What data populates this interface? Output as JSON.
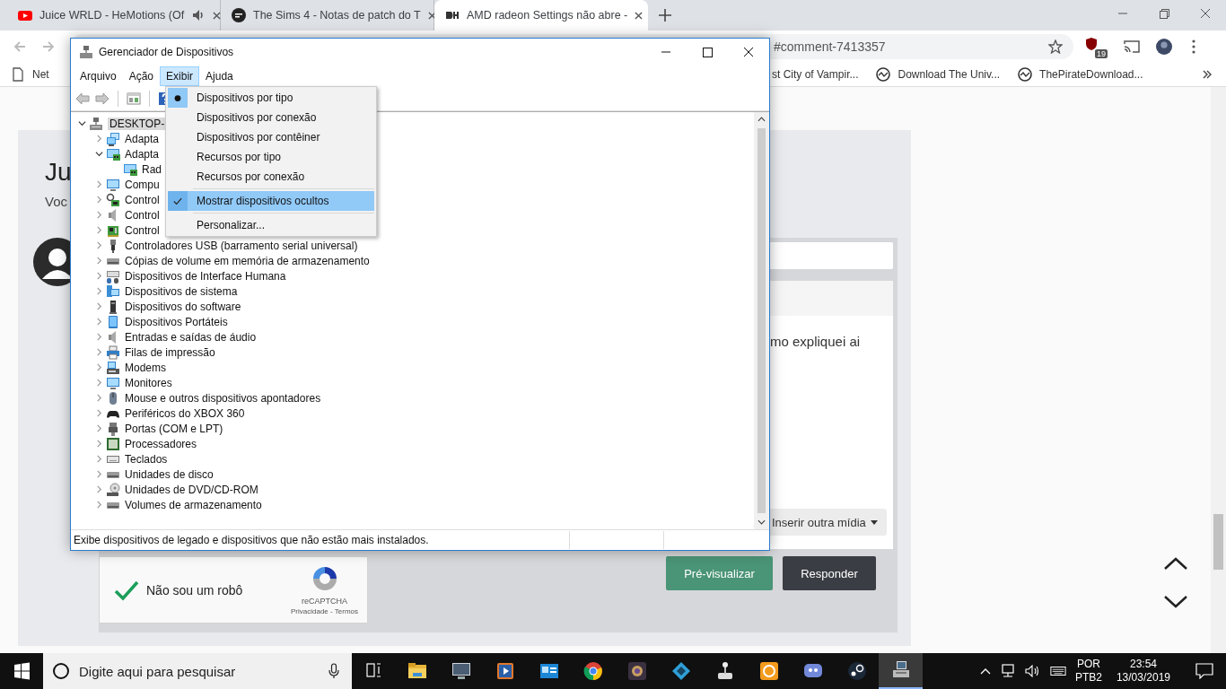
{
  "browser": {
    "tabs": [
      {
        "title": "Juice WRLD - HeMotions (Of",
        "kind": "youtube",
        "audio": true,
        "selected": false
      },
      {
        "title": "The Sims 4 - Notas de patch do T",
        "kind": "ea",
        "audio": false,
        "selected": false
      },
      {
        "title": "AMD radeon Settings não abre -",
        "kind": "logo",
        "audio": false,
        "selected": true
      }
    ],
    "address": "#comment-7413357",
    "extension_badge": "19",
    "bookmarks": [
      {
        "label": "Net",
        "kind": "page"
      },
      {
        "label": "st City of Vampir...",
        "kind": "none"
      },
      {
        "label": "Download The Univ...",
        "kind": "circle"
      },
      {
        "label": "ThePirateDownload...",
        "kind": "circle"
      }
    ]
  },
  "page": {
    "heading": "Ju",
    "subtext": "Voc",
    "editor_text": "mo expliquei ai",
    "media_button": "Inserir outra mídia",
    "captcha": {
      "label": "Não sou um robô",
      "checked": true,
      "brand": "reCAPTCHA",
      "links": "Privacidade - Termos"
    },
    "buttons": [
      {
        "label": "Pré-visualizar",
        "kind": "primary"
      },
      {
        "label": "Responder",
        "kind": "dark"
      }
    ]
  },
  "device_manager": {
    "title": "Gerenciador de Dispositivos",
    "menus": [
      {
        "label": "Arquivo",
        "selected": false
      },
      {
        "label": "Ação",
        "selected": false
      },
      {
        "label": "Exibir",
        "selected": true
      },
      {
        "label": "Ajuda",
        "selected": false
      }
    ],
    "view_menu": [
      {
        "kind": "radio",
        "label": "Dispositivos por tipo",
        "checked": true,
        "selected": false
      },
      {
        "kind": "radio",
        "label": "Dispositivos por conexão",
        "checked": false,
        "selected": false
      },
      {
        "kind": "radio",
        "label": "Dispositivos por contêiner",
        "checked": false,
        "selected": false
      },
      {
        "kind": "radio",
        "label": "Recursos por tipo",
        "checked": false,
        "selected": false
      },
      {
        "kind": "radio",
        "label": "Recursos por conexão",
        "checked": false,
        "selected": false
      },
      {
        "kind": "separator"
      },
      {
        "kind": "check",
        "label": "Mostrar dispositivos ocultos",
        "checked": true,
        "selected": true
      },
      {
        "kind": "separator"
      },
      {
        "kind": "command",
        "label": "Personalizar...",
        "selected": false
      }
    ],
    "tree": {
      "label": "DESKTOP-",
      "kind": "root",
      "expanded": true,
      "selected": true,
      "children": [
        {
          "label": "Adapta",
          "kind": "network",
          "expanded": false,
          "selected": false
        },
        {
          "label": "Adapta",
          "kind": "display",
          "expanded": true,
          "selected": false,
          "children": [
            {
              "label": "Rad",
              "kind": "display",
              "selected": false
            }
          ]
        },
        {
          "label": "Compu",
          "kind": "computer",
          "expanded": false,
          "selected": false
        },
        {
          "label": "Control",
          "kind": "storage",
          "expanded": false,
          "selected": false
        },
        {
          "label": "Control",
          "kind": "audio",
          "expanded": false,
          "selected": false
        },
        {
          "label": "Control",
          "kind": "card",
          "expanded": false,
          "selected": false
        },
        {
          "label": "Controladores USB (barramento serial universal)",
          "kind": "usb",
          "expanded": false,
          "selected": false
        },
        {
          "label": "Cópias de volume em memória de armazenamento",
          "kind": "drive",
          "expanded": false,
          "selected": false
        },
        {
          "label": "Dispositivos de Interface Humana",
          "kind": "hid",
          "expanded": false,
          "selected": false
        },
        {
          "label": "Dispositivos de sistema",
          "kind": "system",
          "expanded": false,
          "selected": false
        },
        {
          "label": "Dispositivos do software",
          "kind": "tower",
          "expanded": false,
          "selected": false
        },
        {
          "label": "Dispositivos Portáteis",
          "kind": "tablet",
          "expanded": false,
          "selected": false
        },
        {
          "label": "Entradas e saídas de áudio",
          "kind": "audio",
          "expanded": false,
          "selected": false
        },
        {
          "label": "Filas de impressão",
          "kind": "printer",
          "expanded": false,
          "selected": false
        },
        {
          "label": "Modems",
          "kind": "modem",
          "expanded": false,
          "selected": false
        },
        {
          "label": "Monitores",
          "kind": "computer",
          "expanded": false,
          "selected": false
        },
        {
          "label": "Mouse e outros dispositivos apontadores",
          "kind": "mouse",
          "expanded": false,
          "selected": false
        },
        {
          "label": "Periféricos do XBOX 360",
          "kind": "gamepad",
          "expanded": false,
          "selected": false
        },
        {
          "label": "Portas (COM e LPT)",
          "kind": "port",
          "expanded": false,
          "selected": false
        },
        {
          "label": "Processadores",
          "kind": "chip",
          "expanded": false,
          "selected": false
        },
        {
          "label": "Teclados",
          "kind": "keyboard",
          "expanded": false,
          "selected": false
        },
        {
          "label": "Unidades de disco",
          "kind": "drive",
          "expanded": false,
          "selected": false
        },
        {
          "label": "Unidades de DVD/CD-ROM",
          "kind": "dvd",
          "expanded": false,
          "selected": false
        },
        {
          "label": "Volumes de armazenamento",
          "kind": "drive",
          "expanded": false,
          "selected": false
        }
      ]
    },
    "status": "Exibe dispositivos de legado e dispositivos que não estão mais instalados."
  },
  "taskbar": {
    "search_placeholder": "Digite aqui para pesquisar",
    "apps": [
      {
        "kind": "folder",
        "active": false
      },
      {
        "kind": "monitor",
        "active": false
      },
      {
        "kind": "media",
        "active": false
      },
      {
        "kind": "card",
        "active": false
      },
      {
        "kind": "browser",
        "active": false
      },
      {
        "kind": "game",
        "active": false
      },
      {
        "kind": "diamond",
        "active": false
      },
      {
        "kind": "joystick",
        "active": false
      },
      {
        "kind": "orange",
        "active": false
      },
      {
        "kind": "chat",
        "active": false
      },
      {
        "kind": "steam",
        "active": false
      },
      {
        "kind": "devices",
        "active": true
      }
    ],
    "language": "POR",
    "layout": "PTB2",
    "time": "23:54",
    "date": "13/03/2019"
  }
}
